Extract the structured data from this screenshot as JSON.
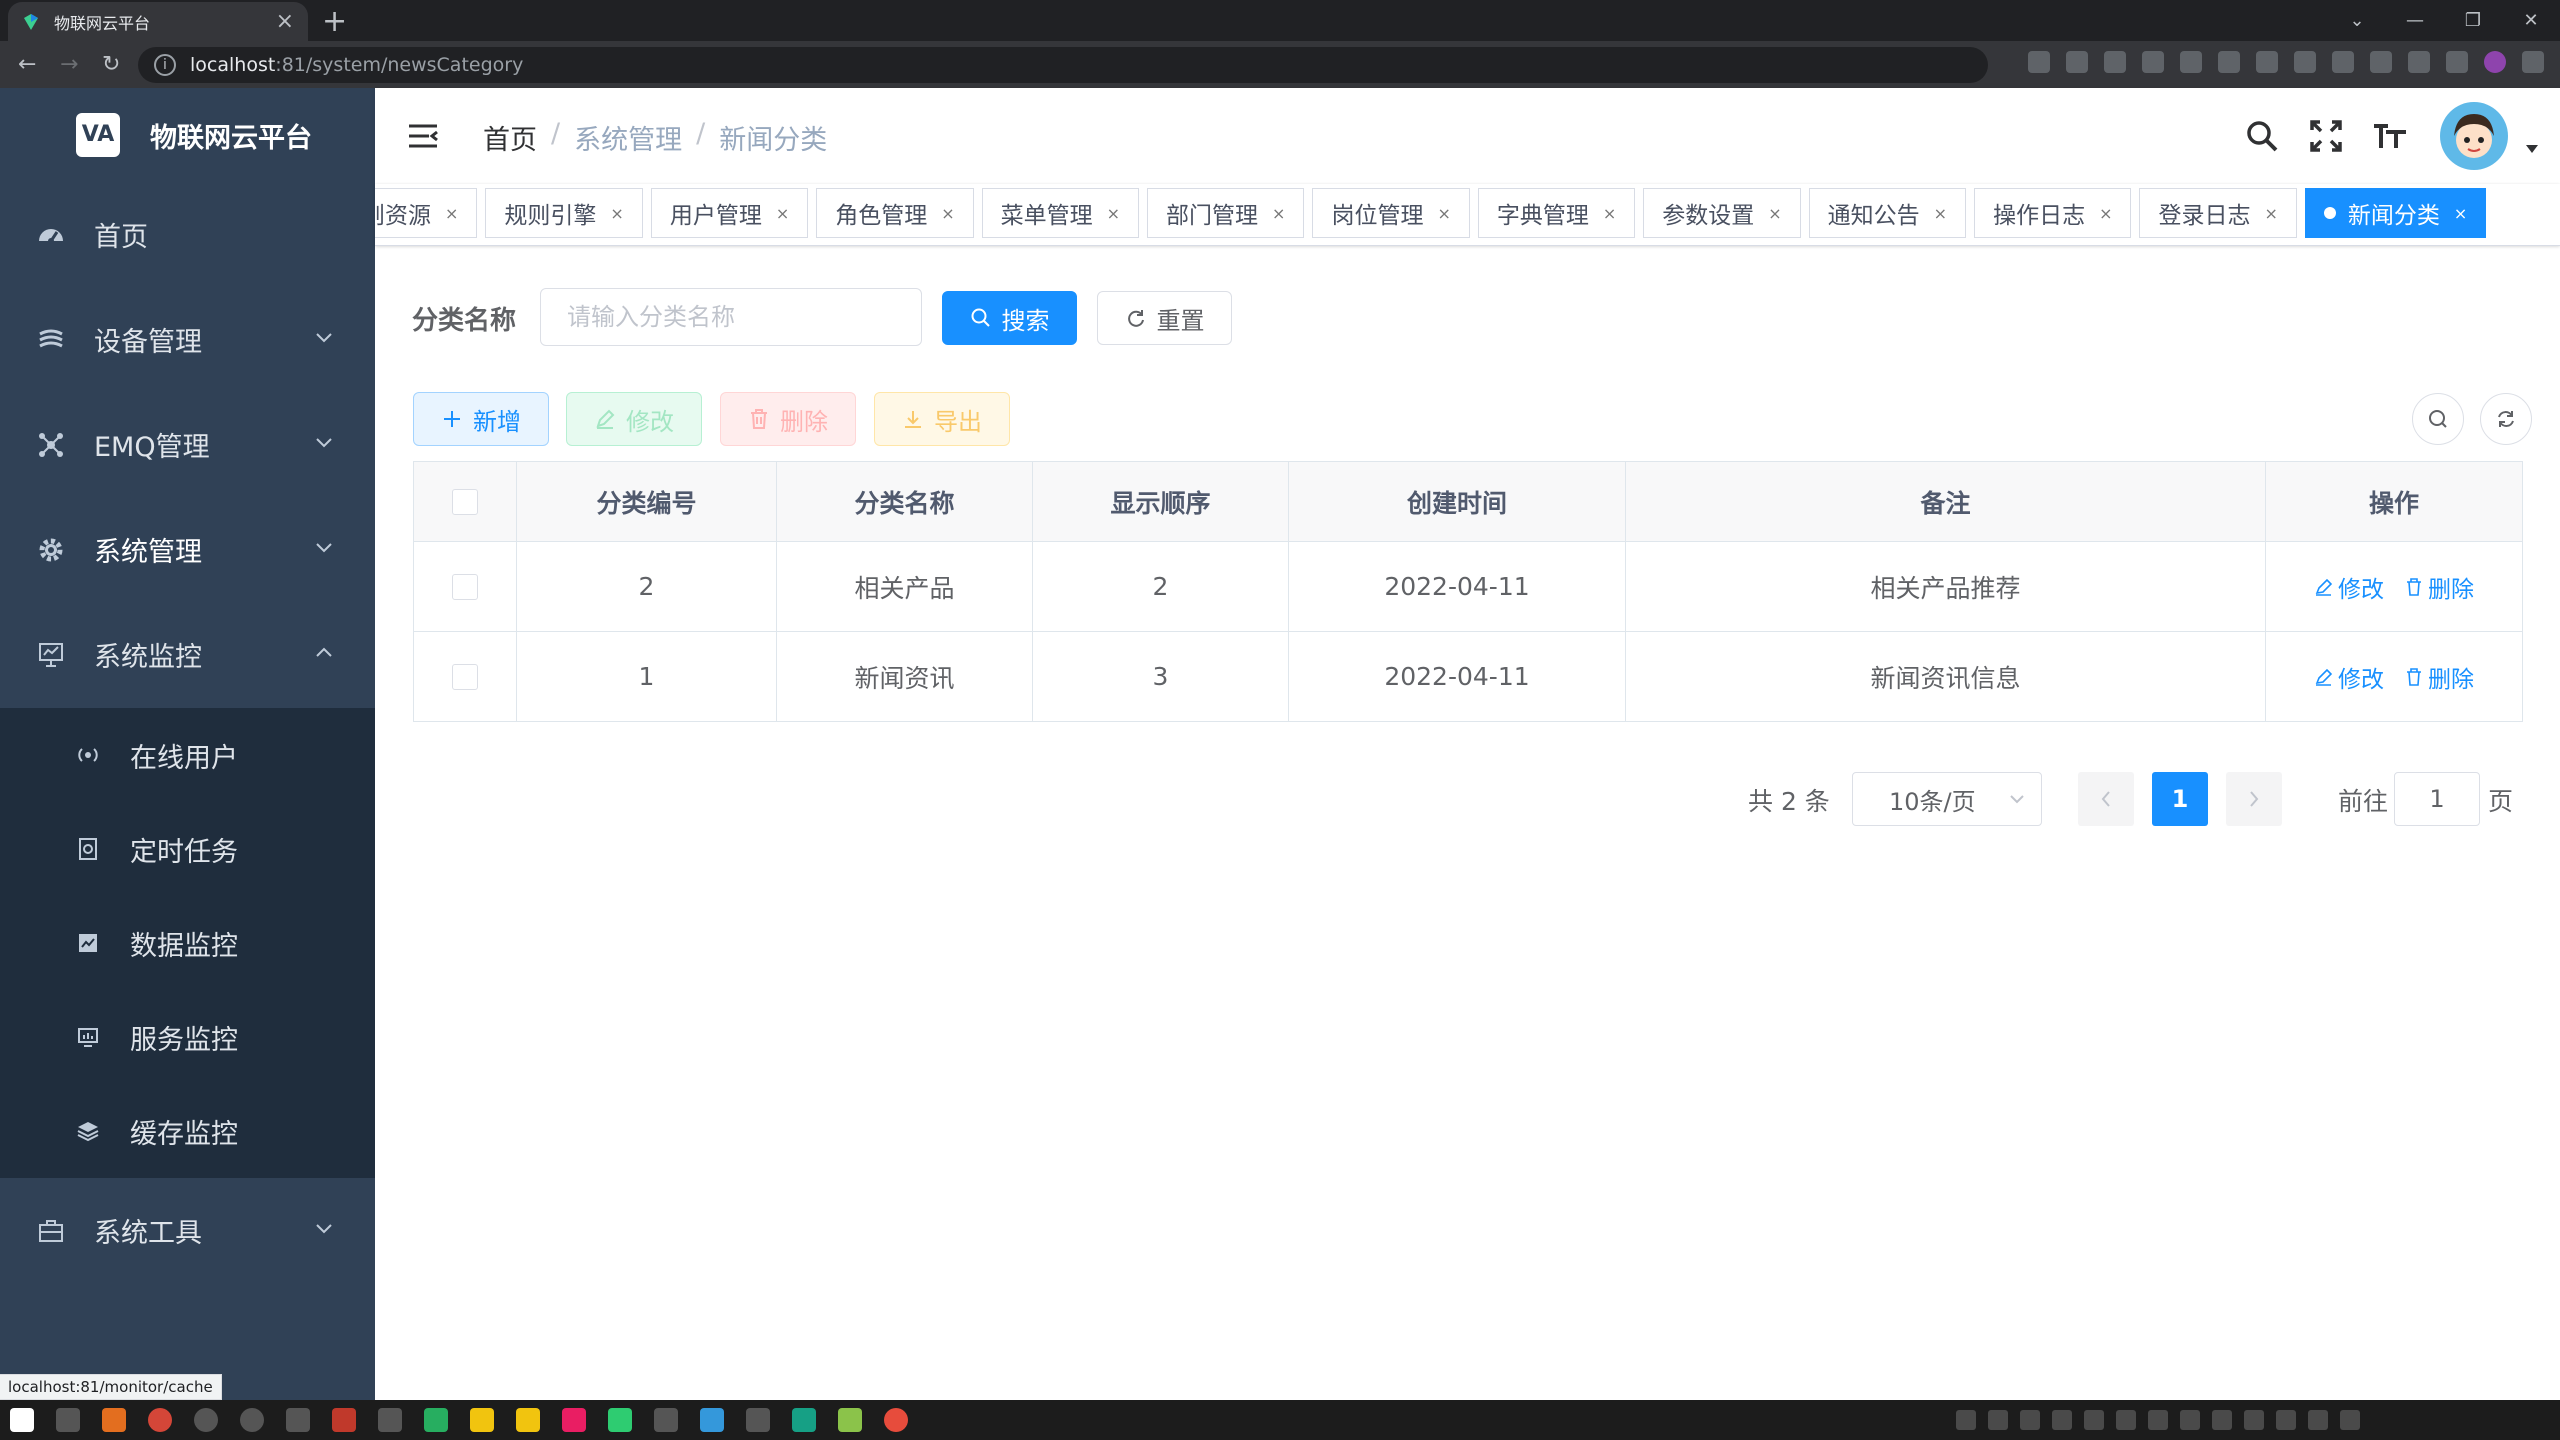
{
  "browser": {
    "tab_title": "物联网云平台",
    "tab_close": "×",
    "new_tab": "+",
    "url_host": "localhost",
    "url_rest": ":81/system/newsCategory",
    "status_url": "localhost:81/monitor/cache"
  },
  "app": {
    "logo_mark": "VA",
    "name": "物联网云平台"
  },
  "sidebar": {
    "items": [
      {
        "label": "首页"
      },
      {
        "label": "设备管理"
      },
      {
        "label": "EMQ管理"
      },
      {
        "label": "系统管理"
      },
      {
        "label": "系统监控"
      },
      {
        "label": "系统工具"
      }
    ],
    "submenu": [
      {
        "label": "在线用户"
      },
      {
        "label": "定时任务"
      },
      {
        "label": "数据监控"
      },
      {
        "label": "服务监控"
      },
      {
        "label": "缓存监控"
      }
    ]
  },
  "breadcrumb": {
    "home": "首页",
    "sep": "/",
    "level1": "系统管理",
    "level2": "新闻分类"
  },
  "tags": [
    "则资源",
    "规则引擎",
    "用户管理",
    "角色管理",
    "菜单管理",
    "部门管理",
    "岗位管理",
    "字典管理",
    "参数设置",
    "通知公告",
    "操作日志",
    "登录日志",
    "新闻分类"
  ],
  "tag_close": "×",
  "query": {
    "label": "分类名称",
    "placeholder": "请输入分类名称",
    "search": "搜索",
    "reset": "重置"
  },
  "toolbar": {
    "add": "新增",
    "edit": "修改",
    "delete": "删除",
    "export": "导出"
  },
  "table": {
    "headers": [
      "分类编号",
      "分类名称",
      "显示顺序",
      "创建时间",
      "备注",
      "操作"
    ],
    "rows": [
      {
        "id": "2",
        "name": "相关产品",
        "order": "2",
        "created": "2022-04-11",
        "remark": "相关产品推荐",
        "edit": "修改",
        "del": "删除"
      },
      {
        "id": "1",
        "name": "新闻资讯",
        "order": "3",
        "created": "2022-04-11",
        "remark": "新闻资讯信息",
        "edit": "修改",
        "del": "删除"
      }
    ]
  },
  "pagination": {
    "total": "共 2 条",
    "page_size": "10条/页",
    "current": "1",
    "goto": "前往",
    "jump_value": "1",
    "page": "页"
  },
  "colors": {
    "primary": "#1890ff",
    "sidebar": "#304156",
    "submenu": "#1f2d3d"
  }
}
